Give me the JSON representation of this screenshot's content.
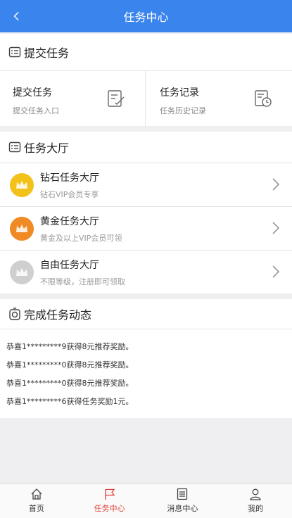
{
  "header": {
    "title": "任务中心"
  },
  "submit_section": {
    "heading": "提交任务",
    "cells": [
      {
        "title": "提交任务",
        "subtitle": "提交任务入口"
      },
      {
        "title": "任务记录",
        "subtitle": "任务历史记录"
      }
    ]
  },
  "hall_section": {
    "heading": "任务大厅",
    "items": [
      {
        "title": "钻石任务大厅",
        "subtitle": "钻石VIP会员专享",
        "medal_color": "#f2c21a"
      },
      {
        "title": "黄金任务大厅",
        "subtitle": "黄金及以上VIP会员可领",
        "medal_color": "#f08a24"
      },
      {
        "title": "自由任务大厅",
        "subtitle": "不限等级，注册即可领取",
        "medal_color": "#cfcfcf"
      }
    ]
  },
  "feed_section": {
    "heading": "完成任务动态",
    "lines": [
      "恭喜1*********9获得8元推荐奖励。",
      "恭喜1*********0获得8元推荐奖励。",
      "恭喜1*********0获得8元推荐奖励。",
      "恭喜1*********6获得任务奖励1元。"
    ]
  },
  "tabbar": {
    "tabs": [
      {
        "label": "首页",
        "icon": "home-icon"
      },
      {
        "label": "任务中心",
        "icon": "flag-icon"
      },
      {
        "label": "消息中心",
        "icon": "list-icon"
      },
      {
        "label": "我的",
        "icon": "user-icon"
      }
    ]
  },
  "colors": {
    "header": "#3a84ee",
    "active_tab": "#e0403a"
  }
}
